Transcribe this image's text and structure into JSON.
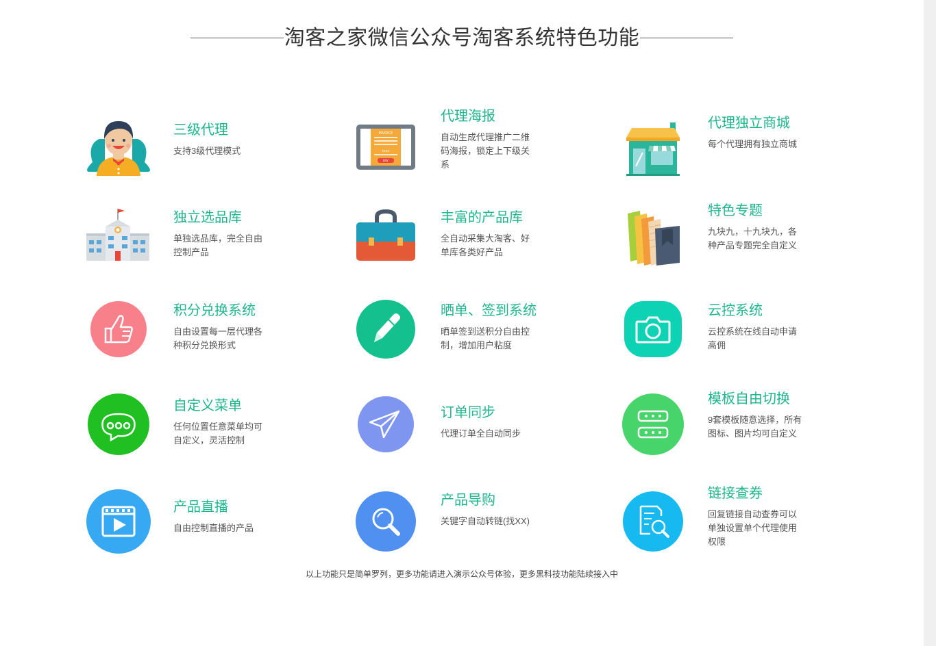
{
  "title": "淘客之家微信公众号淘客系统特色功能",
  "features": [
    {
      "title": "三级代理",
      "desc": "支持3级代理模式",
      "icon": "agent-person-icon"
    },
    {
      "title": "代理海报",
      "desc": "自动生成代理推广二维码海报，锁定上下级关系",
      "icon": "poster-invoice-icon"
    },
    {
      "title": "代理独立商城",
      "desc": "每个代理拥有独立商城",
      "icon": "storefront-icon"
    },
    {
      "title": "独立选品库",
      "desc": "单独选品库，完全自由控制产品",
      "icon": "building-icon"
    },
    {
      "title": "丰富的产品库",
      "desc": "全自动采集大淘客、好单库各类好产品",
      "icon": "briefcase-icon"
    },
    {
      "title": "特色专题",
      "desc": "九块九，十九块九，各种产品专题完全自定义",
      "icon": "books-icon"
    },
    {
      "title": "积分兑换系统",
      "desc": "自由设置每一层代理各种积分兑换形式",
      "icon": "thumbs-up-icon"
    },
    {
      "title": "晒单、签到系统",
      "desc": "晒单签到送积分自由控制，增加用户粘度",
      "icon": "pen-icon"
    },
    {
      "title": "云控系统",
      "desc": "云控系统在线自动申请高佣",
      "icon": "camera-icon"
    },
    {
      "title": "自定义菜单",
      "desc": "任何位置任意菜单均可自定义，灵活控制",
      "icon": "chat-bubble-icon"
    },
    {
      "title": "订单同步",
      "desc": "代理订单全自动同步",
      "icon": "paper-plane-icon"
    },
    {
      "title": "模板自由切换",
      "desc": "9套模板随意选择，所有图标、图片均可自定义",
      "icon": "template-switch-icon"
    },
    {
      "title": "产品直播",
      "desc": "自由控制直播的产品",
      "icon": "video-play-icon"
    },
    {
      "title": "产品导购",
      "desc": "关键字自动转链(找XX)",
      "icon": "search-icon"
    },
    {
      "title": "链接查券",
      "desc": "回复链接自动查券可以单独设置单个代理使用权限",
      "icon": "document-search-icon"
    }
  ],
  "poster_labels": {
    "invoice": "INVOICE",
    "amount": "$$$$",
    "pay": "PAY"
  },
  "footer": "以上功能只是简单罗列，更多功能请进入演示公众号体验，更多黑科技功能陆续接入中",
  "colors": {
    "accent": "#1fb58f",
    "pink": "#f7808a",
    "green_pen": "#14c08d",
    "teal_camera": "#0dd3b4",
    "green_chat": "#20c023",
    "periwinkle_plane": "#7f96f0",
    "green_template": "#47d46a",
    "blue_video": "#37a8f2",
    "blue_search": "#5090f0",
    "cyan_doc": "#16b9f0"
  }
}
